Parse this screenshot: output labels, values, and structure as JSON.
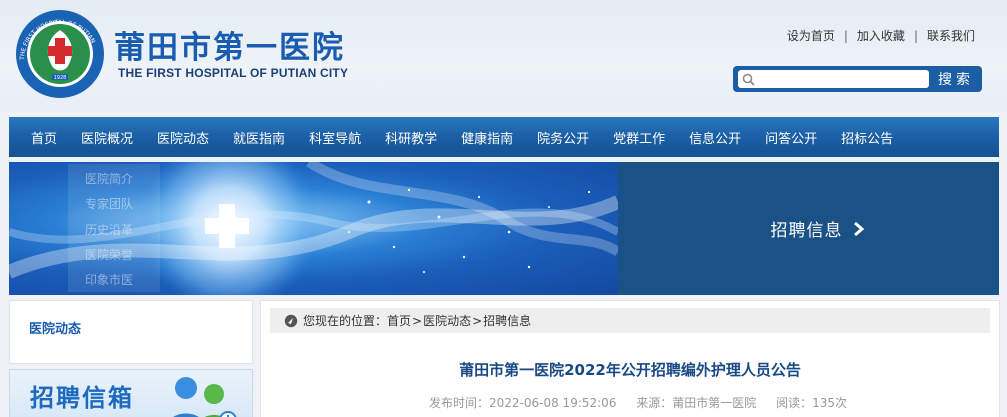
{
  "header": {
    "logo_title": "莆田市第一医院",
    "logo_subtitle": "THE FIRST HOSPITAL OF PUTIAN CITY",
    "logo_ring_text": "THE FIRST HOSPITAL OF PUTIAN",
    "logo_year": "1928",
    "top_links": [
      "设为首页",
      "加入收藏",
      "联系我们"
    ]
  },
  "search": {
    "placeholder": "",
    "button_label": "搜索"
  },
  "nav": {
    "items": [
      "首页",
      "医院概况",
      "医院动态",
      "就医指南",
      "科室导航",
      "科研教学",
      "健康指南",
      "院务公开",
      "党群工作",
      "信息公开",
      "问答公开",
      "招标公告"
    ]
  },
  "banner": {
    "title": "招聘信息",
    "submenu": [
      "医院简介",
      "专家团队",
      "历史沿革",
      "医院荣誉",
      "印象市医"
    ]
  },
  "sidebar": {
    "section_title": "医院动态",
    "mailbox_title": "招聘信箱"
  },
  "breadcrumb": {
    "prefix": "您现在的位置：",
    "items": [
      "首页",
      "医院动态",
      "招聘信息"
    ],
    "separator": ">"
  },
  "article": {
    "title": "莆田市第一医院2022年公开招聘编外护理人员公告",
    "publish_time": "发布时间：2022-06-08 19:52:06",
    "source": "来源：莆田市第一医院",
    "views": "阅读：135次"
  },
  "colors": {
    "brand": "#1a5cb0",
    "nav": "#1b5fa6",
    "banner_right": "#1a5186"
  }
}
